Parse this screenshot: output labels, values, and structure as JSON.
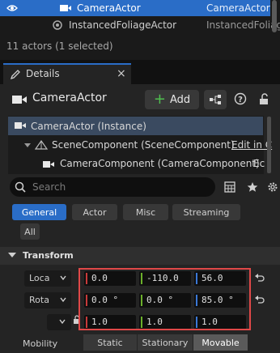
{
  "outliner": {
    "rows": [
      {
        "name": "CameraActor",
        "type": "CameraActor",
        "selected": true
      },
      {
        "name": "InstancedFoliageActor",
        "type": "InstancedFoliag",
        "selected": false
      }
    ],
    "actor_count": "11 actors (1 selected)"
  },
  "details_tab": {
    "label": "Details",
    "close": "×"
  },
  "header": {
    "actor_name": "CameraActor",
    "add_label": "Add"
  },
  "components": {
    "root": "CameraActor (Instance)",
    "scene": "SceneComponent (SceneComponent)",
    "scene_link": "Edit in C",
    "camera": "CameraComponent (CameraComponent)",
    "camera_link": "Ec"
  },
  "search": {
    "placeholder": "Search"
  },
  "filters": {
    "general": "General",
    "actor": "Actor",
    "misc": "Misc",
    "streaming": "Streaming",
    "all": "All"
  },
  "transform": {
    "title": "Transform",
    "location": {
      "label": "Loca",
      "x": "0.0",
      "y": "-110.0",
      "z": "56.0"
    },
    "rotation": {
      "label": "Rota",
      "x": "0.0 °",
      "y": "0.0 °",
      "z": "85.0 °"
    },
    "scale": {
      "label": "",
      "x": "1.0",
      "y": "1.0",
      "z": "1.0"
    },
    "mobility": {
      "label": "Mobility",
      "options": [
        "Static",
        "Stationary",
        "Movable"
      ],
      "selected": "Movable"
    }
  },
  "colors": {
    "accent": "#2a6dc7",
    "x_axis": "#c83a3a",
    "y_axis": "#6bb02a",
    "z_axis": "#3a78d6",
    "highlight": "#e04848"
  }
}
